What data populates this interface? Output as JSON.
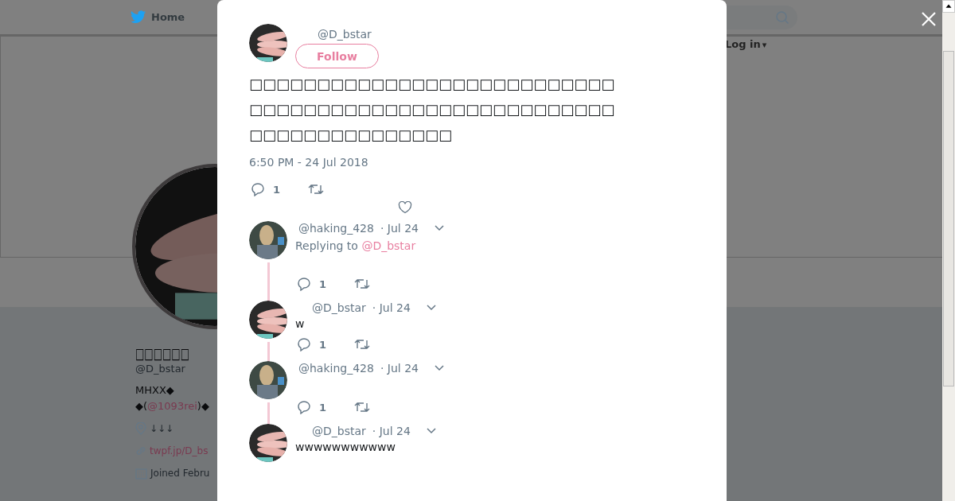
{
  "nav": {
    "home": "Home",
    "login": "Log in",
    "login_caret": "▾"
  },
  "profile": {
    "name": "□□□□□□",
    "handle": "@D_bstar",
    "bio_line": "MHXX◆",
    "bio_prefix": "◆(",
    "bio_mention": "@1093rei",
    "bio_suffix": ")◆",
    "location": "↓↓↓",
    "url": "twpf.jp/D_bs",
    "joined": "Joined Febru"
  },
  "tweet": {
    "handle": "@D_bstar",
    "follow": "Follow",
    "text": "□□□□□□□□□□□□□□□□□□□□□□□□□□□□□□□□□□□□□□□□□□□□□□□□□□□□□□□□□□□□□□□□□□□□□",
    "time": "6:50 PM - 24 Jul 2018",
    "replies": "1"
  },
  "thread": [
    {
      "kind": "other",
      "handle": "@haking_428",
      "date": "· Jul 24",
      "replying_label": "Replying to",
      "replying_to": "@D_bstar",
      "replies": "1"
    },
    {
      "kind": "self",
      "handle": "@D_bstar",
      "date": "· Jul 24",
      "text": "w",
      "replies": "1"
    },
    {
      "kind": "other",
      "handle": "@haking_428",
      "date": "· Jul 24",
      "replies": "1"
    },
    {
      "kind": "self",
      "handle": "@D_bstar",
      "date": "· Jul 24",
      "text": "wwwwwwwwwww"
    }
  ]
}
